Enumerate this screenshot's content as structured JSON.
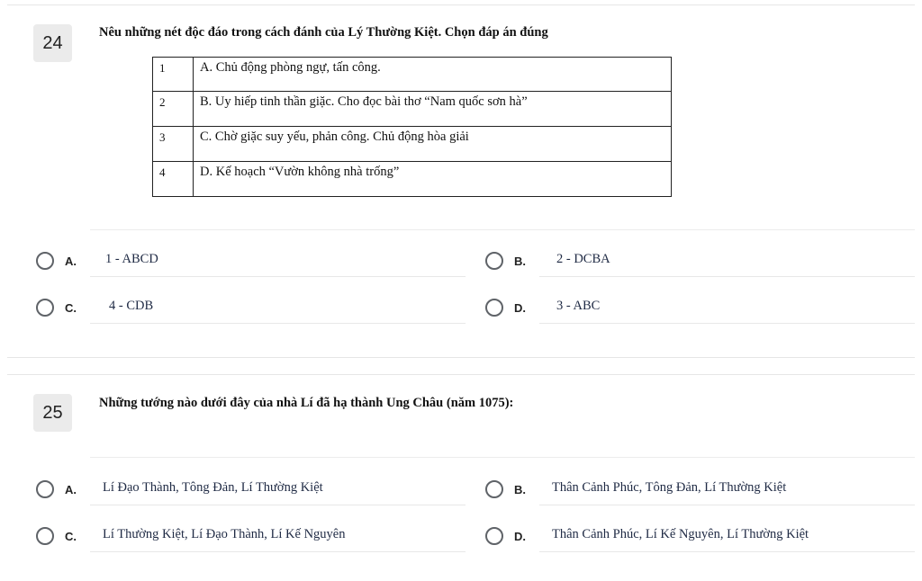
{
  "questions": [
    {
      "number": "24",
      "text": "Nêu những nét độc đáo trong cách đánh của Lý Thường Kiệt. Chọn đáp án đúng",
      "table": [
        {
          "idx": "1",
          "text": "A. Chủ động phòng ngự, tấn công."
        },
        {
          "idx": "2",
          "text": "B. Uy hiếp tinh thần giặc. Cho đọc bài thơ “Nam quốc sơn hà”"
        },
        {
          "idx": "3",
          "text": "C. Chờ giặc suy yếu, phản công. Chủ động hòa giải"
        },
        {
          "idx": "4",
          "text": "D. Kế hoạch “Vườn không nhà trống”"
        }
      ],
      "options": [
        {
          "letter": "A.",
          "text": "1 - ABCD"
        },
        {
          "letter": "B.",
          "text": "2 - DCBA"
        },
        {
          "letter": "C.",
          "text": "4 - CDB"
        },
        {
          "letter": "D.",
          "text": "3 - ABC"
        }
      ]
    },
    {
      "number": "25",
      "text": "Những tướng nào dưới đây của nhà Lí đã hạ thành Ung Châu (năm 1075):",
      "options": [
        {
          "letter": "A.",
          "text": "Lí Đạo Thành, Tông Đản, Lí Thường Kiệt"
        },
        {
          "letter": "B.",
          "text": "Thân Cảnh Phúc, Tông Đản, Lí Thường Kiệt"
        },
        {
          "letter": "C.",
          "text": "Lí Thường Kiệt, Lí Đạo Thành, Lí Kế Nguyên"
        },
        {
          "letter": "D.",
          "text": "Thân Cảnh Phúc, Lí Kế Nguyên, Lí Thường Kiệt"
        }
      ]
    }
  ]
}
